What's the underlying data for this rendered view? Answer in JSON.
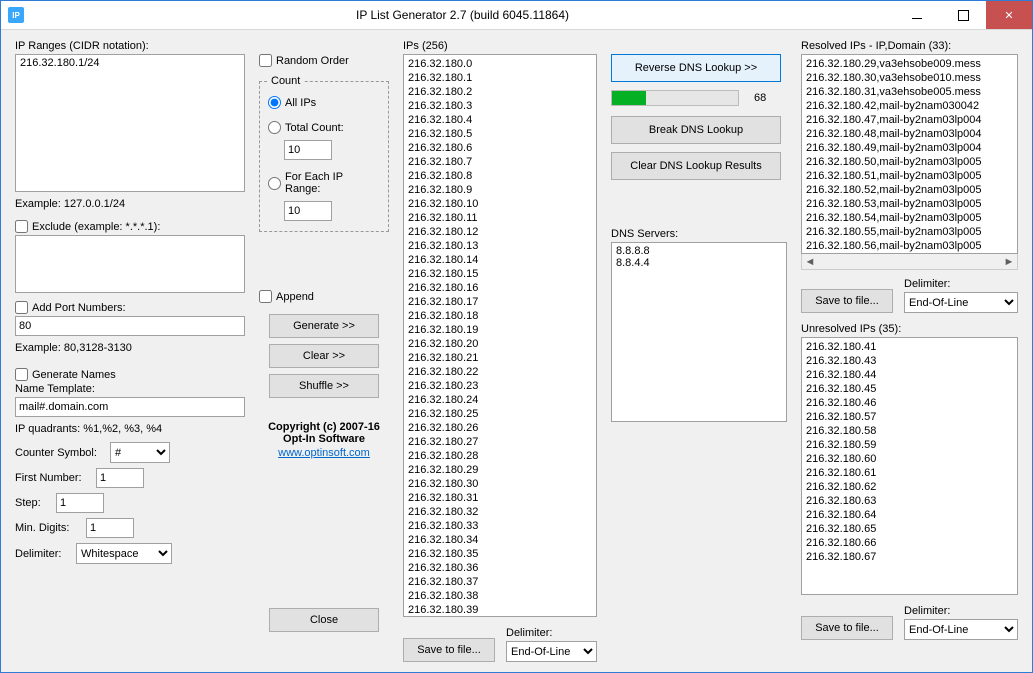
{
  "window": {
    "title": "IP List Generator 2.7 (build 6045.11864)",
    "icon_text": "IP"
  },
  "col1": {
    "ip_ranges_label": "IP Ranges (CIDR notation):",
    "ip_ranges_value": "216.32.180.1/24",
    "ip_ranges_example": "Example: 127.0.0.1/24",
    "exclude_label": "Exclude (example: *.*.*.1):",
    "exclude_value": "",
    "addport_label": "Add Port Numbers:",
    "addport_value": "80",
    "addport_example": "Example: 80,3128-3130",
    "genNames_label": "Generate Names",
    "nameTemplate_label": "Name Template:",
    "nameTemplate_value": "mail#.domain.com",
    "quadrants_label": "IP quadrants: %1,%2, %3, %4",
    "counterSymbol_label": "Counter Symbol:",
    "counterSymbol_value": "#",
    "firstNumber_label": "First Number:",
    "firstNumber_value": "1",
    "step_label": "Step:",
    "step_value": "1",
    "minDigits_label": "Min. Digits:",
    "minDigits_value": "1",
    "delimiter_label": "Delimiter:",
    "delimiter_value": "Whitespace"
  },
  "col2": {
    "randomOrder_label": "Random Order",
    "count_legend": "Count",
    "allIPs_label": "All IPs",
    "totalCount_label": "Total Count:",
    "totalCount_value": "10",
    "forEach_label": "For Each IP Range:",
    "forEach_value": "10",
    "append_label": "Append",
    "generate_btn": "Generate >>",
    "clear_btn": "Clear >>",
    "shuffle_btn": "Shuffle >>",
    "copyright1": "Copyright (c) 2007-16",
    "copyright2": "Opt-In Software",
    "url": "www.optinsoft.com",
    "close_btn": "Close"
  },
  "col3": {
    "ips_label": "IPs (256)",
    "ips_list": "216.32.180.0\n216.32.180.1\n216.32.180.2\n216.32.180.3\n216.32.180.4\n216.32.180.5\n216.32.180.6\n216.32.180.7\n216.32.180.8\n216.32.180.9\n216.32.180.10\n216.32.180.11\n216.32.180.12\n216.32.180.13\n216.32.180.14\n216.32.180.15\n216.32.180.16\n216.32.180.17\n216.32.180.18\n216.32.180.19\n216.32.180.20\n216.32.180.21\n216.32.180.22\n216.32.180.23\n216.32.180.24\n216.32.180.25\n216.32.180.26\n216.32.180.27\n216.32.180.28\n216.32.180.29\n216.32.180.30\n216.32.180.31\n216.32.180.32\n216.32.180.33\n216.32.180.34\n216.32.180.35\n216.32.180.36\n216.32.180.37\n216.32.180.38\n216.32.180.39",
    "save_btn": "Save to file...",
    "delimiter_label": "Delimiter:",
    "delimiter_value": "End-Of-Line"
  },
  "col4": {
    "reverse_btn": "Reverse DNS Lookup >>",
    "progress_value": 27,
    "progress_text": "68",
    "break_btn": "Break DNS Lookup",
    "clear_btn": "Clear DNS Lookup Results",
    "dnsServers_label": "DNS Servers:",
    "dnsServers_value": "8.8.8.8\n8.8.4.4"
  },
  "col5": {
    "resolved_label": "Resolved IPs - IP,Domain (33):",
    "resolved_list": "216.32.180.29,va3ehsobe009.mess\n216.32.180.30,va3ehsobe010.mess\n216.32.180.31,va3ehsobe005.mess\n216.32.180.42,mail-by2nam030042\n216.32.180.47,mail-by2nam03lp004\n216.32.180.48,mail-by2nam03lp004\n216.32.180.49,mail-by2nam03lp004\n216.32.180.50,mail-by2nam03lp005\n216.32.180.51,mail-by2nam03lp005\n216.32.180.52,mail-by2nam03lp005\n216.32.180.53,mail-by2nam03lp005\n216.32.180.54,mail-by2nam03lp005\n216.32.180.55,mail-by2nam03lp005\n216.32.180.56,mail-by2nam03lp005",
    "resolved_save_btn": "Save to file...",
    "resolved_delim_label": "Delimiter:",
    "resolved_delim_value": "End-Of-Line",
    "unresolved_label": "Unresolved IPs (35):",
    "unresolved_list": "216.32.180.41\n216.32.180.43\n216.32.180.44\n216.32.180.45\n216.32.180.46\n216.32.180.57\n216.32.180.58\n216.32.180.59\n216.32.180.60\n216.32.180.61\n216.32.180.62\n216.32.180.63\n216.32.180.64\n216.32.180.65\n216.32.180.66\n216.32.180.67",
    "unresolved_save_btn": "Save to file...",
    "unresolved_delim_label": "Delimiter:",
    "unresolved_delim_value": "End-Of-Line"
  }
}
